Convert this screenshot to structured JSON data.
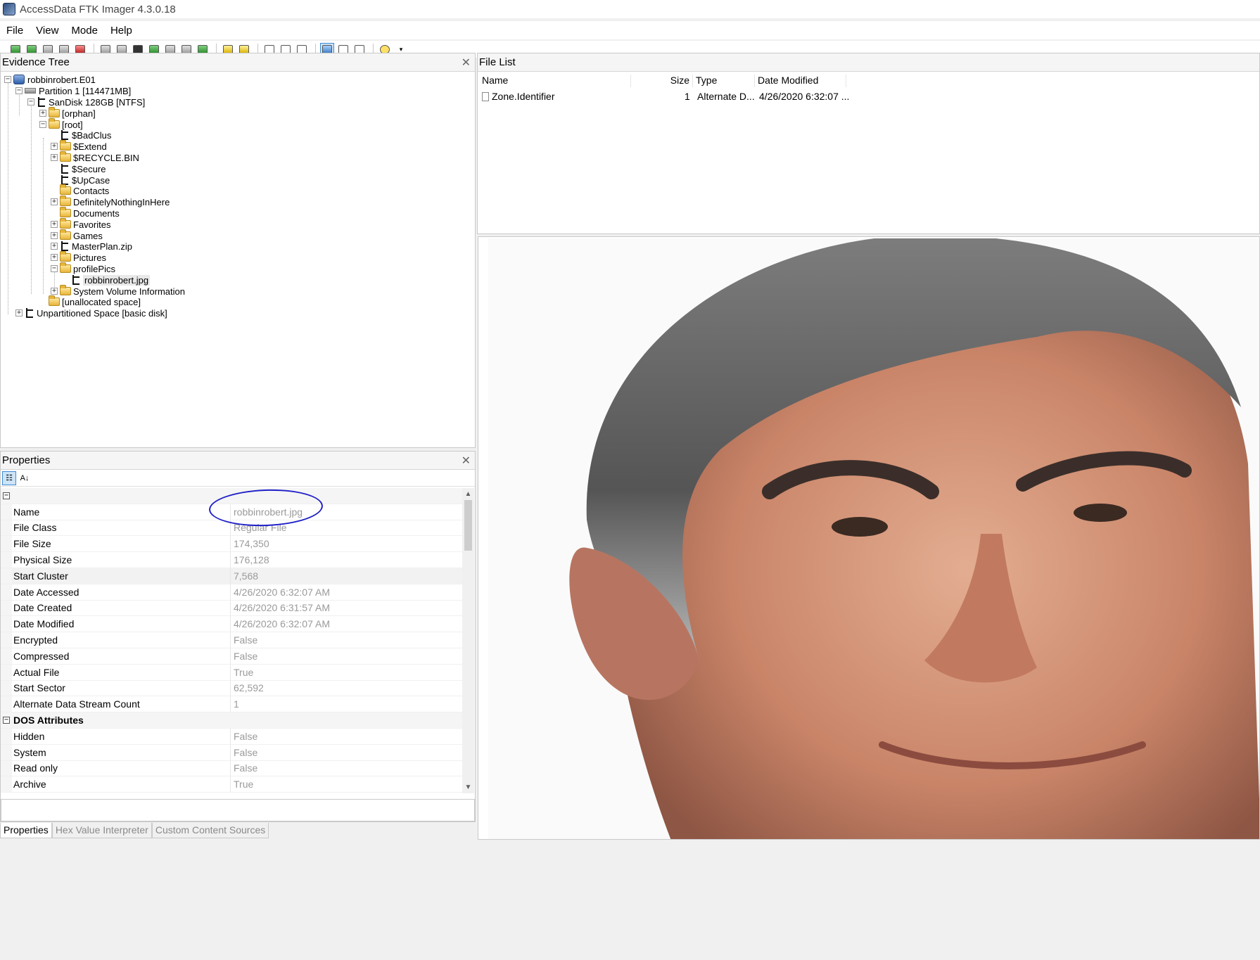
{
  "window": {
    "title": "AccessData FTK Imager 4.3.0.18"
  },
  "menu": [
    "File",
    "View",
    "Mode",
    "Help"
  ],
  "toolbar_icons": [
    "add-evidence-icon",
    "add-all-evidence-icon",
    "image-mounting-icon",
    "remove-evidence-icon",
    "remove-all-icon",
    "create-disk-image-icon",
    "export-disk-image-icon",
    "export-logical-image-icon",
    "add-to-custom-content-icon",
    "create-custom-content-image-icon",
    "decrypt-icon",
    "capture-memory-icon",
    "obtain-protected-files-icon",
    "detect-encryption-icon",
    "export-files-icon",
    "export-file-hash-list-icon",
    "export-directory-listing-icon",
    "auto-view-icon",
    "text-view-icon",
    "hex-view-icon",
    "help-icon",
    "more-icon"
  ],
  "evidence_tree": {
    "title": "Evidence Tree",
    "nodes": [
      {
        "label": "robbinrobert.E01"
      },
      {
        "label": "Partition 1 [114471MB]"
      },
      {
        "label": "SanDisk 128GB [NTFS]"
      },
      {
        "label": "[orphan]"
      },
      {
        "label": "[root]"
      },
      {
        "label": "$BadClus"
      },
      {
        "label": "$Extend"
      },
      {
        "label": "$RECYCLE.BIN"
      },
      {
        "label": "$Secure"
      },
      {
        "label": "$UpCase"
      },
      {
        "label": "Contacts"
      },
      {
        "label": "DefinitelyNothingInHere"
      },
      {
        "label": "Documents"
      },
      {
        "label": "Favorites"
      },
      {
        "label": "Games"
      },
      {
        "label": "MasterPlan.zip"
      },
      {
        "label": "Pictures"
      },
      {
        "label": "profilePics"
      },
      {
        "label": "robbinrobert.jpg"
      },
      {
        "label": "System Volume Information"
      },
      {
        "label": "[unallocated space]"
      },
      {
        "label": "Unpartitioned Space [basic disk]"
      }
    ]
  },
  "properties": {
    "title": "Properties",
    "rows": [
      {
        "key": "Name",
        "value": "robbinrobert.jpg"
      },
      {
        "key": "File Class",
        "value": "Regular File"
      },
      {
        "key": "File Size",
        "value": "174,350"
      },
      {
        "key": "Physical Size",
        "value": "176,128"
      },
      {
        "key": "Start Cluster",
        "value": "7,568"
      },
      {
        "key": "Date Accessed",
        "value": "4/26/2020 6:32:07 AM"
      },
      {
        "key": "Date Created",
        "value": "4/26/2020 6:31:57 AM"
      },
      {
        "key": "Date Modified",
        "value": "4/26/2020 6:32:07 AM"
      },
      {
        "key": "Encrypted",
        "value": "False"
      },
      {
        "key": "Compressed",
        "value": "False"
      },
      {
        "key": "Actual File",
        "value": "True"
      },
      {
        "key": "Start Sector",
        "value": "62,592"
      },
      {
        "key": "Alternate Data Stream Count",
        "value": "1"
      }
    ],
    "dos_category": "DOS Attributes",
    "dos_rows": [
      {
        "key": "Hidden",
        "value": "False"
      },
      {
        "key": "System",
        "value": "False"
      },
      {
        "key": "Read only",
        "value": "False"
      },
      {
        "key": "Archive",
        "value": "True"
      }
    ]
  },
  "bottom_tabs": [
    "Properties",
    "Hex Value Interpreter",
    "Custom Content Sources"
  ],
  "file_list": {
    "title": "File List",
    "columns": [
      "Name",
      "Size",
      "Type",
      "Date Modified"
    ],
    "rows": [
      {
        "name": "Zone.Identifier",
        "size": "1",
        "type": "Alternate D...",
        "modified": "4/26/2020 6:32:07 ..."
      }
    ]
  }
}
